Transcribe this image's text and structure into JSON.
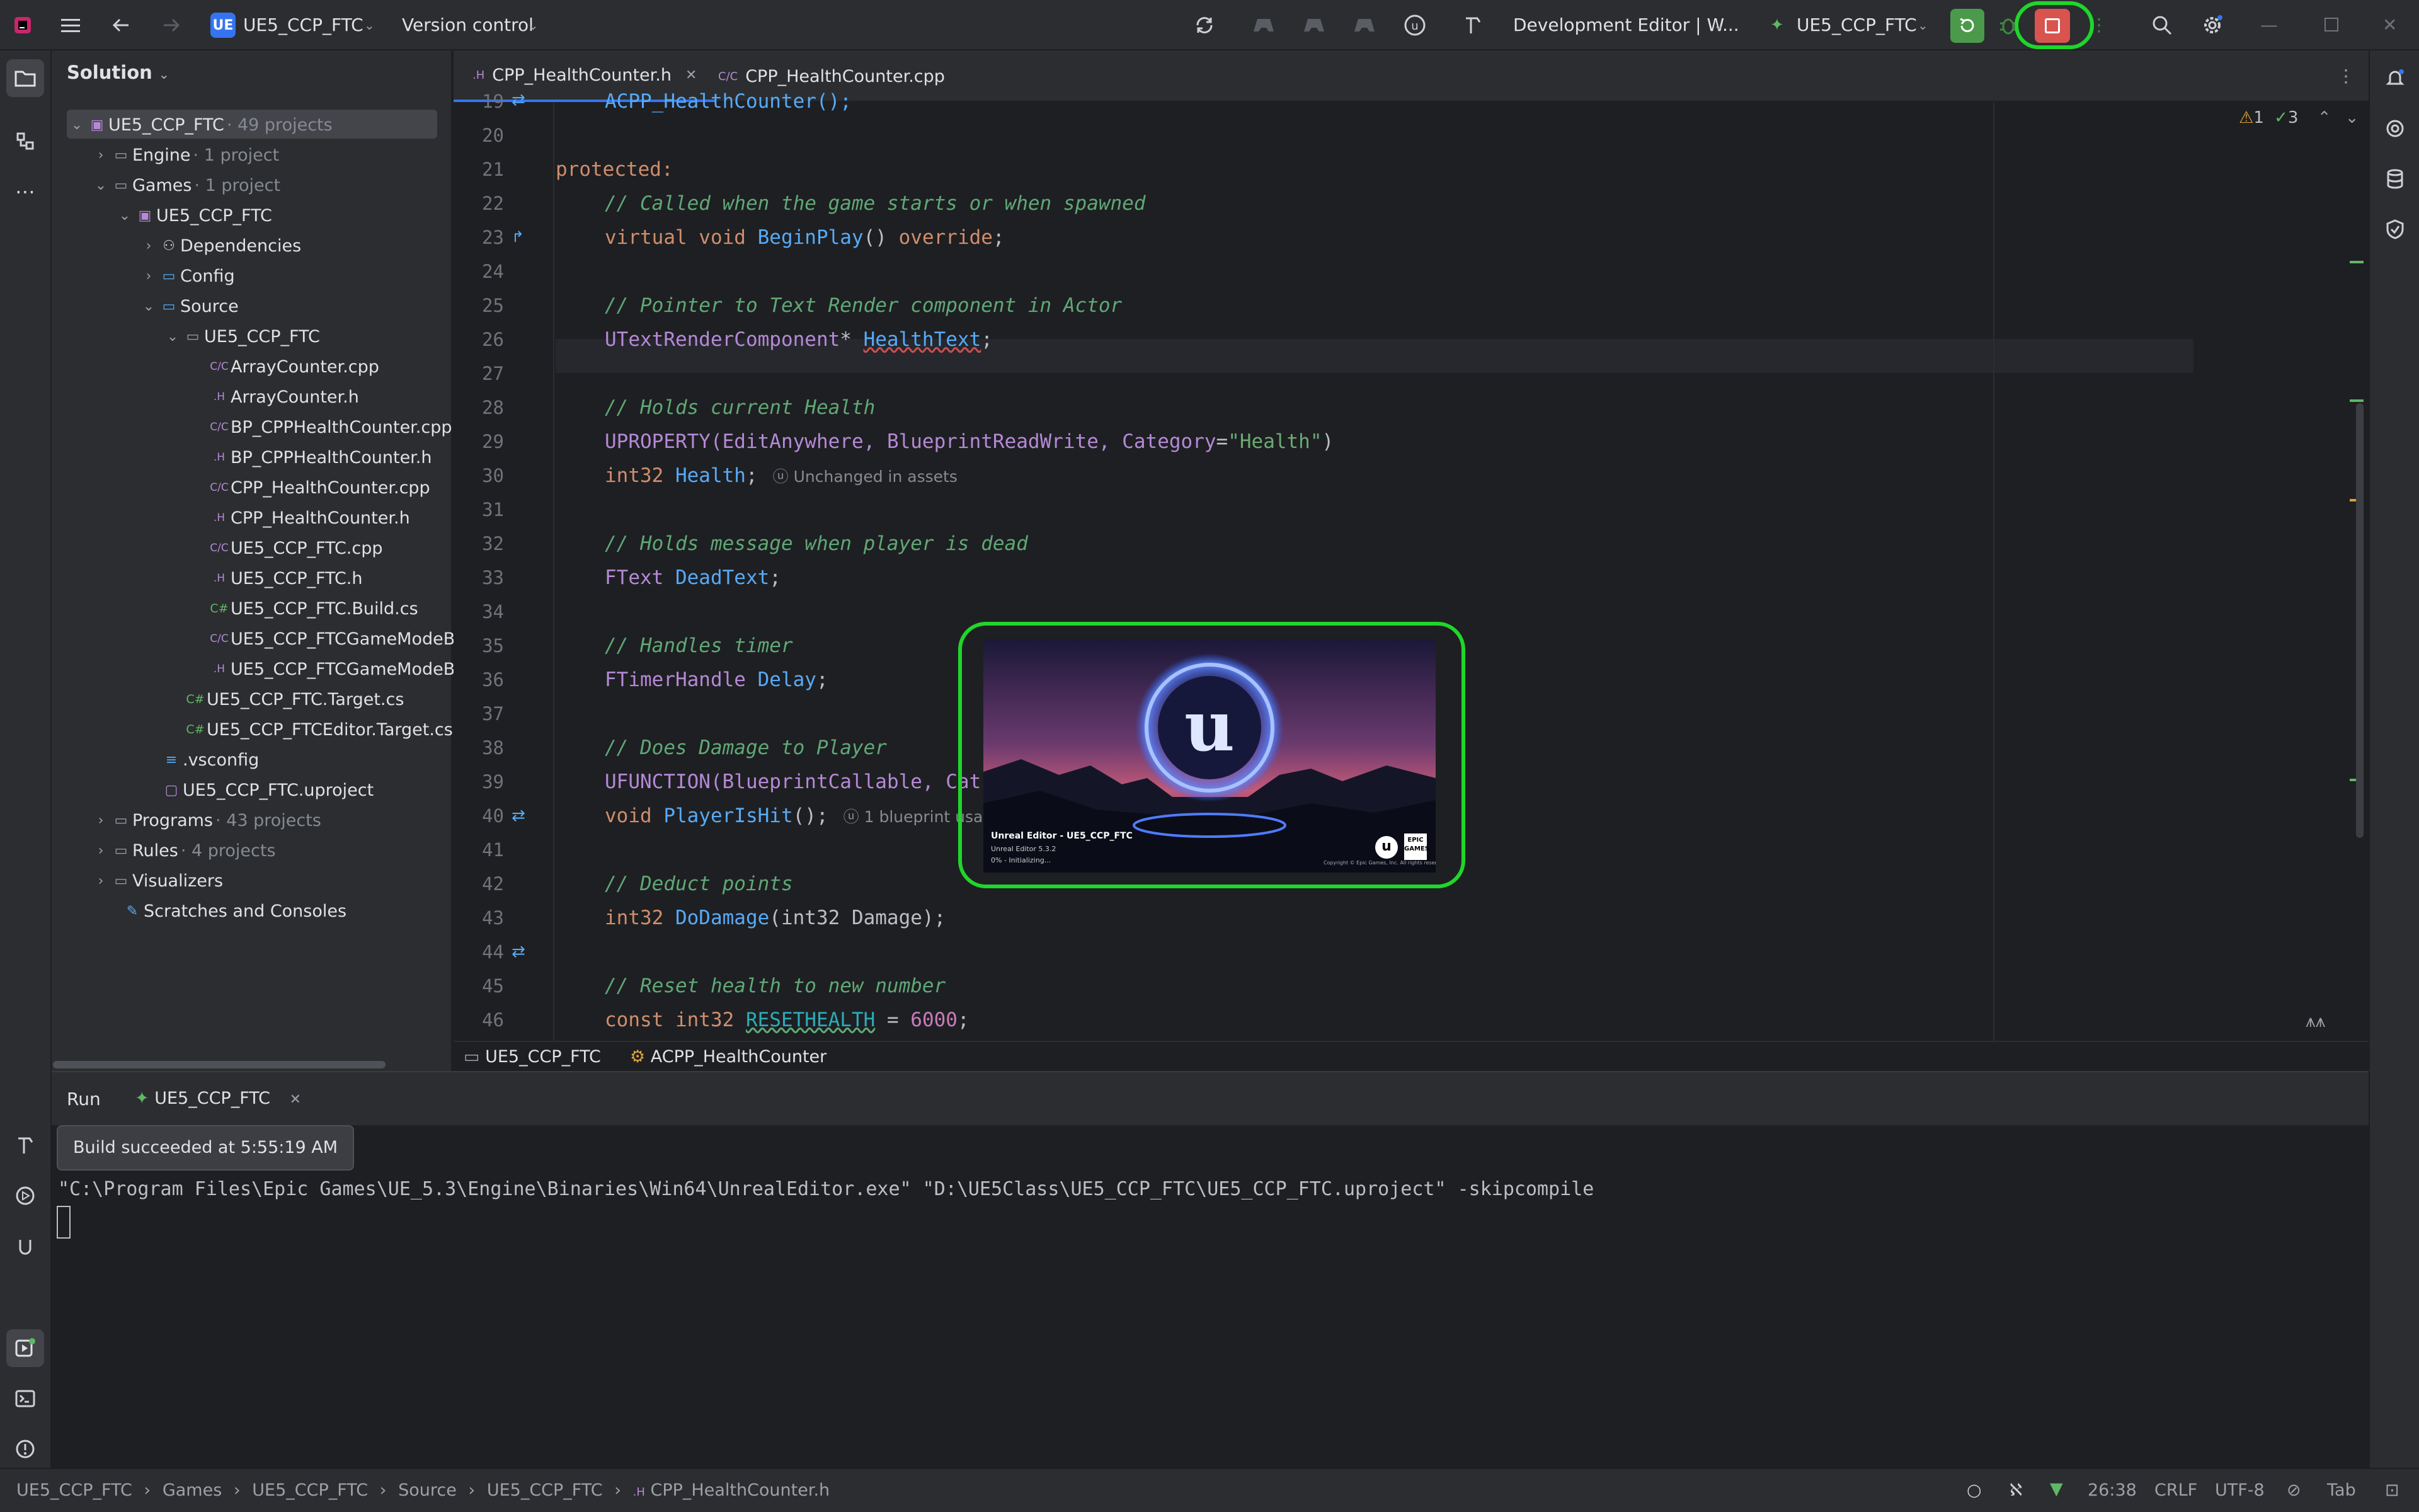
{
  "toolbar": {
    "project": "UE5_CCP_FTC",
    "project_badge": "UE",
    "vcs": "Version control",
    "config": "Development Editor | W...",
    "run_target": "UE5_CCP_FTC",
    "icons": [
      "main-menu-icon",
      "back-icon",
      "forward-icon",
      "sync-icon",
      "controller-icon",
      "controller-icon",
      "controller-icon",
      "unreal-icon",
      "hammer-icon",
      "rerun-icon",
      "debug-icon",
      "stop-icon",
      "search-icon",
      "settings-icon"
    ]
  },
  "sidebar": {
    "title": "Solution",
    "tree": [
      {
        "label": "UE5_CCP_FTC",
        "sub": "· 49 projects"
      },
      {
        "label": "Engine",
        "sub": "· 1 project"
      },
      {
        "label": "Games",
        "sub": "· 1 project"
      },
      {
        "label": "UE5_CCP_FTC",
        "sub": ""
      },
      {
        "label": "Dependencies",
        "sub": ""
      },
      {
        "label": "Config",
        "sub": ""
      },
      {
        "label": "Source",
        "sub": ""
      },
      {
        "label": "UE5_CCP_FTC",
        "sub": ""
      },
      {
        "label": "ArrayCounter.cpp",
        "sub": ""
      },
      {
        "label": "ArrayCounter.h",
        "sub": ""
      },
      {
        "label": "BP_CPPHealthCounter.cpp",
        "sub": ""
      },
      {
        "label": "BP_CPPHealthCounter.h",
        "sub": ""
      },
      {
        "label": "CPP_HealthCounter.cpp",
        "sub": ""
      },
      {
        "label": "CPP_HealthCounter.h",
        "sub": ""
      },
      {
        "label": "UE5_CCP_FTC.cpp",
        "sub": ""
      },
      {
        "label": "UE5_CCP_FTC.h",
        "sub": ""
      },
      {
        "label": "UE5_CCP_FTC.Build.cs",
        "sub": ""
      },
      {
        "label": "UE5_CCP_FTCGameModeB",
        "sub": ""
      },
      {
        "label": "UE5_CCP_FTCGameModeB",
        "sub": ""
      },
      {
        "label": "UE5_CCP_FTC.Target.cs",
        "sub": ""
      },
      {
        "label": "UE5_CCP_FTCEditor.Target.cs",
        "sub": ""
      },
      {
        "label": ".vsconfig",
        "sub": ""
      },
      {
        "label": "UE5_CCP_FTC.uproject",
        "sub": ""
      },
      {
        "label": "Programs",
        "sub": "· 43 projects"
      },
      {
        "label": "Rules",
        "sub": "· 4 projects"
      },
      {
        "label": "Visualizers",
        "sub": ""
      },
      {
        "label": "Scratches and Consoles",
        "sub": ""
      }
    ]
  },
  "editor": {
    "tabs": [
      "CPP_HealthCounter.h",
      "CPP_HealthCounter.cpp"
    ],
    "tab_badges": [
      ".H",
      "C/C"
    ],
    "inspection_warn": "1",
    "inspection_ok": "3",
    "line_numbers": [
      "19",
      "20",
      "21",
      "22",
      "23",
      "24",
      "25",
      "26",
      "27",
      "28",
      "29",
      "30",
      "31",
      "32",
      "33",
      "34",
      "35",
      "36",
      "37",
      "38",
      "39",
      "40",
      "41",
      "42",
      "43",
      "44",
      "45",
      "46"
    ],
    "code": {
      "l19": "ACPP_HealthCounter();",
      "l21": "protected:",
      "l22": "// Called when the game starts or when spawned",
      "l23a": "virtual void ",
      "l23b": "BeginPlay",
      "l23c": "() ",
      "l23d": "override",
      "l23e": ";",
      "l25": "// Pointer to Text Render component in Actor",
      "l26a": "UTextRenderComponent",
      "l26b": "* ",
      "l26c": "HealthText",
      "l26d": ";",
      "l28": "// Holds current Health",
      "l29a": "UPROPERTY",
      "l29b": "(EditAnywhere, BlueprintReadWrite, ",
      "l29c": "Category",
      "l29d": "=",
      "l29e": "\"Health\"",
      "l29f": ")",
      "l30a": "int32 ",
      "l30b": "Health",
      "l30c": ";",
      "l30hint": "Unchanged in assets",
      "l32": "// Holds message when player is dead",
      "l33a": "FText ",
      "l33b": "DeadText",
      "l33c": ";",
      "l35": "// Handles timer",
      "l36a": "FTimerHandle ",
      "l36b": "Delay",
      "l36c": ";",
      "l38": "// Does Damage to Player",
      "l39a": "UFUNCTION",
      "l39b": "(BlueprintCallable, Cat",
      "l40a": "void ",
      "l40b": "PlayerIsHit",
      "l40c": "();",
      "l40hint": "1 blueprint usa",
      "l42": "// Deduct points",
      "l43a": "int32 ",
      "l43b": "DoDamage",
      "l43c": "(int32 Damage);",
      "l45": "// Reset health to new number",
      "l46a": "const int32 ",
      "l46b": "RESETHEALTH",
      "l46c": " = ",
      "l46d": "6000",
      "l46e": ";"
    },
    "breadcrumb": [
      "UE5_CCP_FTC",
      "ACPP_HealthCounter"
    ]
  },
  "splash": {
    "title": "Unreal Editor - UE5_CCP_FTC",
    "version": "Unreal Editor 5.3.2",
    "progress": "0% - Initializing...",
    "copyright": "Copyright © Epic Games, Inc. All rights reserved.",
    "epic_top": "EPIC",
    "epic_bottom": "GAMES"
  },
  "run": {
    "label": "Run",
    "tab": "UE5_CCP_FTC",
    "tooltip": "Build succeeded at 5:55:19 AM",
    "command": "\"C:\\Program Files\\Epic Games\\UE_5.3\\Engine\\Binaries\\Win64\\UnrealEditor.exe\" \"D:\\UE5Class\\UE5_CCP_FTC\\UE5_CCP_FTC.uproject\" -skipcompile"
  },
  "statusbar": {
    "path": [
      "UE5_CCP_FTC",
      "Games",
      "UE5_CCP_FTC",
      "Source",
      "UE5_CCP_FTC",
      "CPP_HealthCounter.h"
    ],
    "position": "26:38",
    "line_ending": "CRLF",
    "encoding": "UTF-8",
    "indent": "Tab"
  },
  "colors": {
    "accent": "#3574f0",
    "highlight": "#1fd62a",
    "stop": "#d9534f",
    "run": "#4b9a4b"
  }
}
